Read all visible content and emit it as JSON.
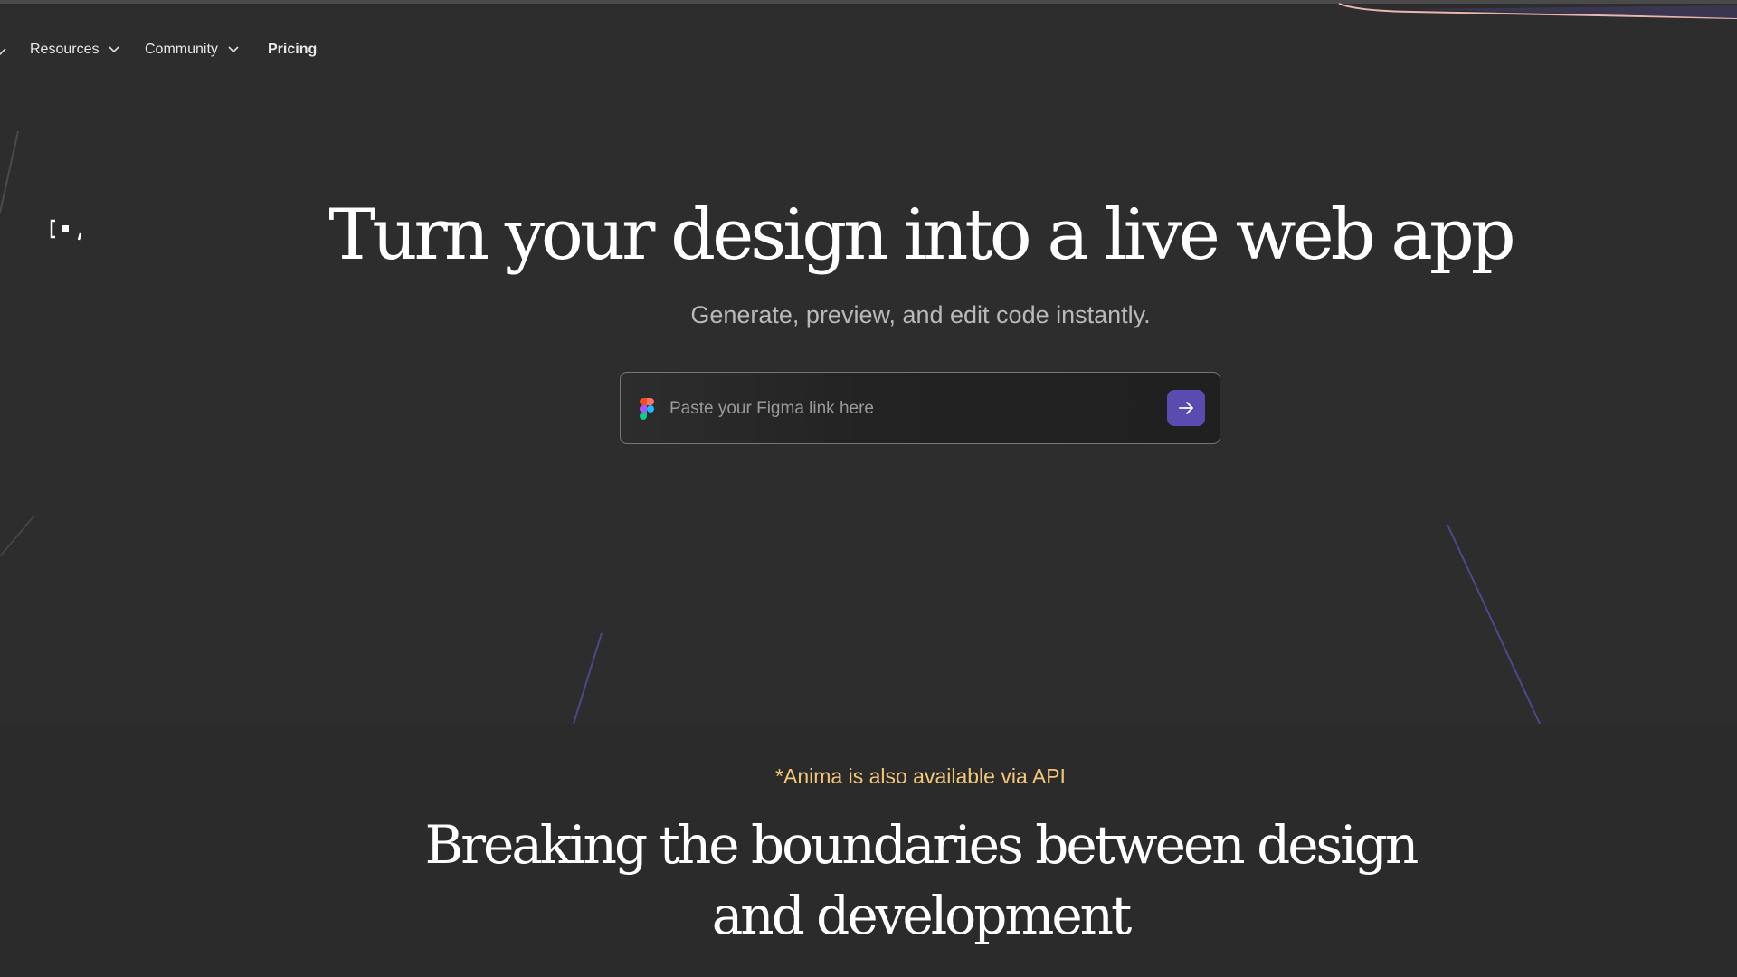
{
  "nav": {
    "items": [
      {
        "label": "Resources",
        "has_dropdown": true
      },
      {
        "label": "Community",
        "has_dropdown": true
      },
      {
        "label": "Pricing",
        "has_dropdown": false
      }
    ]
  },
  "hero": {
    "title": "Turn your design into a live web app",
    "subtitle": "Generate, preview, and edit code instantly."
  },
  "figma_input": {
    "placeholder": "Paste your Figma link here",
    "value": "",
    "icon": "figma-icon",
    "submit_icon": "arrow-right-icon"
  },
  "api_note": "*Anima is also available via API",
  "section": {
    "title": "Breaking the boundaries between design and development"
  },
  "colors": {
    "background": "#2d2d2d",
    "accent": "#5a4bb0",
    "api_note": "#f3c77a"
  }
}
